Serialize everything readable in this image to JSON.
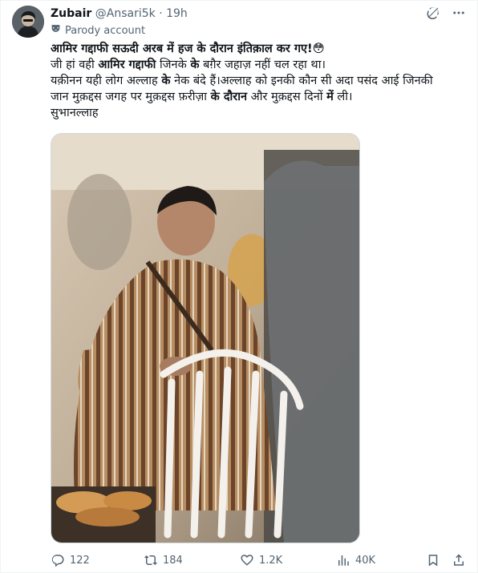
{
  "tweet": {
    "author_name": "Zubair",
    "handle": "@Ansari5k",
    "separator": "·",
    "time": "19h",
    "parody_label": "Parody account",
    "line1_bold": "आमिर गद्दाफी सऊदी अरब में हज के दौरान  इंतिक़ाल कर गए!",
    "line1_emoji": "😳",
    "line2_a": "जी हां वही ",
    "line2_b": "आमिर गद्दाफी",
    "line2_c": " जिनके ",
    "line2_d": "के",
    "line2_e": " बग़ैर जहाज़ नहीं चल रहा था।",
    "line3_a": "यक़ीनन यही लोग अल्लाह ",
    "line3_b": "के",
    "line3_c": " नेक बंदे हैं।अल्लाह को इनकी कौन सी अदा पसंद आई जिनकी",
    "line4_a": "जान मुक़द्दस जगह पर मुक़द्दस फ़रीज़ा ",
    "line4_b": "के दौरान",
    "line4_c": " और मुक़द्दस दिनों ",
    "line4_d": "में",
    "line4_e": " ली।",
    "line5": "सुभानल्लाह"
  },
  "actions": {
    "replies": "122",
    "reposts": "184",
    "likes": "1.2K",
    "views": "40K"
  },
  "icons": [
    "grok-icon",
    "more-icon",
    "parody-mask-icon",
    "reply-icon",
    "repost-icon",
    "like-icon",
    "views-icon",
    "bookmark-icon",
    "share-icon"
  ],
  "colors": {
    "text": "#0f1419",
    "secondary": "#536471",
    "border": "#cfd9de"
  }
}
